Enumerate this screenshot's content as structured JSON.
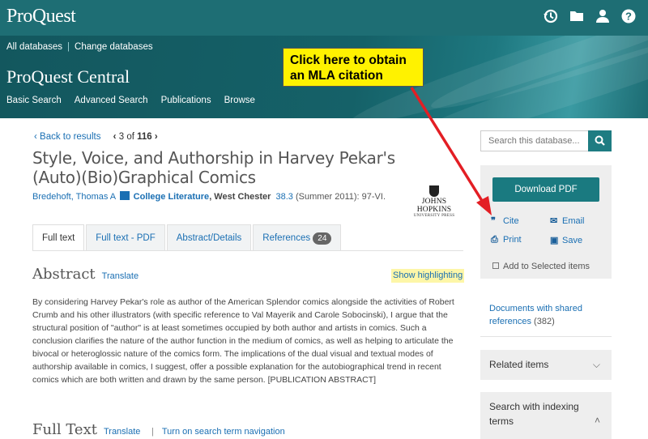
{
  "header": {
    "logo": "ProQuest",
    "icons": [
      "history-icon",
      "folder-icon",
      "user-icon",
      "help-icon"
    ],
    "db_links": [
      "All databases",
      "Change databases"
    ],
    "db_title": "ProQuest Central",
    "nav": [
      "Basic Search",
      "Advanced Search",
      "Publications",
      "Browse"
    ]
  },
  "callout": {
    "line1": "Click here to obtain",
    "line2": "an MLA citation"
  },
  "results_nav": {
    "back": "‹ Back to results",
    "prev": "‹",
    "current": "3",
    "of": "of",
    "total": "116",
    "next": "›"
  },
  "document": {
    "title": "Style, Voice, and Authorship in Harvey Pekar's (Auto)(Bio)Graphical Comics",
    "author": "Bredehoft, Thomas A",
    "journal": "College Literature",
    "place": ", West Chester",
    "volume": "38.3",
    "rest": " (Summer 2011): 97-VI.",
    "publisher_logo": "JOHNS HOPKINS",
    "publisher_sub": "UNIVERSITY PRESS"
  },
  "tabs": [
    {
      "label": "Full text",
      "active": true
    },
    {
      "label": "Full text - PDF"
    },
    {
      "label": "Abstract/Details"
    },
    {
      "label": "References",
      "badge": "24"
    }
  ],
  "abstract": {
    "heading": "Abstract",
    "translate": "Translate",
    "highlight": "Show highlighting",
    "text": "By considering Harvey Pekar's role as author of the American Splendor comics alongside the activities of Robert Crumb and his other illustrators (with specific reference to Val Mayerik and Carole Sobocinski), I argue that the structural position of \"author\" is at least sometimes occupied by both author and artists in comics. Such a conclusion clarifies the nature of the author function in the medium of comics, as well as helping to articulate the bivocal or heteroglossic nature of the comics form. The implications of the dual visual and textual modes of authorship available in comics, I suggest, offer a possible explanation for the autobiographical trend in recent comics which are both written and drawn by the same person. [PUBLICATION ABSTRACT]"
  },
  "fulltext": {
    "heading": "Full Text",
    "translate": "Translate",
    "sep": "|",
    "nav": "Turn on search term navigation"
  },
  "sidebar": {
    "search_placeholder": "Search this database...",
    "download": "Download PDF",
    "cite": "Cite",
    "email": "Email",
    "print": "Print",
    "save": "Save",
    "add_selected": "Add to Selected items",
    "shared_refs_label": "Documents with shared references",
    "shared_refs_count": "(382)",
    "related": "Related items",
    "indexing": "Search with indexing terms"
  },
  "colors": {
    "header": "#1e6e74",
    "accent": "#1a7a80",
    "link": "#1a6fb3",
    "callout": "#fff200",
    "arrow": "#e31e24"
  }
}
